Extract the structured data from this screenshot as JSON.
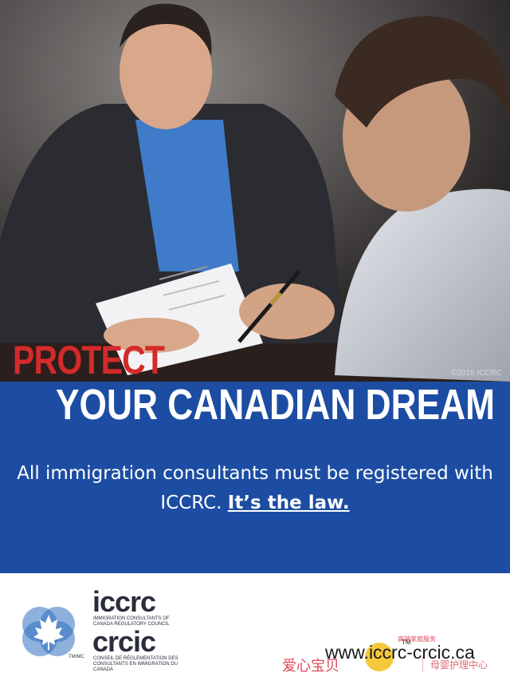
{
  "photo": {
    "copyright": "©2015 ICCRC"
  },
  "headline": {
    "line1": "PROTECT",
    "line2": "YOUR CANADIAN DREAM"
  },
  "message": {
    "text": "All immigration consultants must be registered with ICCRC.",
    "emphasis": "It’s the law."
  },
  "brand": {
    "name_en": "iccrc",
    "sub_en": "Immigration Consultants of Canada Regulatory Council",
    "name_fr": "crcic",
    "sub_fr": "Conseil de réglementation des consultants en immigration du Canada",
    "tm_mc": "TM/MC",
    "url": "www.iccrc-crcic.ca",
    "tm": "TM"
  },
  "watermark": {
    "left": "爱心宝贝",
    "right": "母婴护理中心",
    "chip": "高端家庭服务"
  },
  "colors": {
    "band": "#1c4da3",
    "protect": "#d42a2a",
    "logo_blue": "#2f6fc0"
  }
}
